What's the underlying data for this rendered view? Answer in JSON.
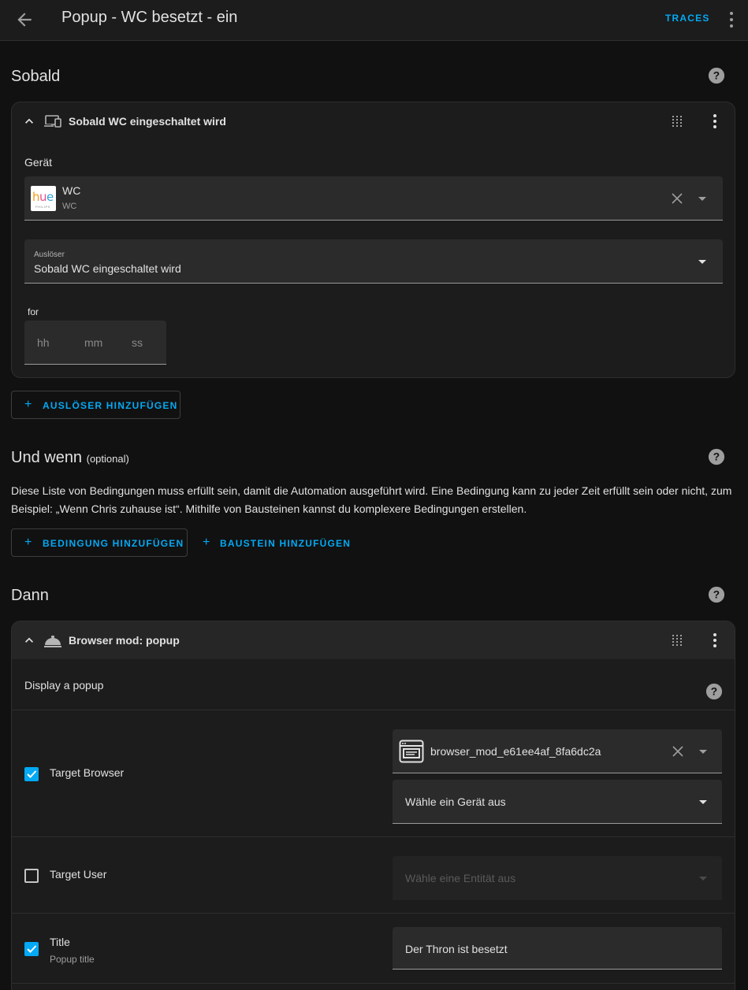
{
  "header": {
    "title": "Popup - WC besetzt - ein",
    "traces_label": "TRACES"
  },
  "triggers": {
    "section_title": "Sobald",
    "card": {
      "title": "Sobald WC eingeschaltet wird",
      "device_label": "Gerät",
      "device": {
        "name": "WC",
        "area": "WC",
        "logo_text": "hue",
        "logo_sub": "PHILIPS"
      },
      "trigger_field": {
        "label": "Auslöser",
        "value": "Sobald WC eingeschaltet wird"
      },
      "for_label": "for",
      "duration": {
        "hh": "hh",
        "mm": "mm",
        "ss": "ss"
      }
    },
    "add_button": "AUSLÖSER HINZUFÜGEN"
  },
  "conditions": {
    "section_title": "Und wenn",
    "optional": "(optional)",
    "description_line1": "Diese Liste von Bedingungen muss erfüllt sein, damit die Automation ausgeführt wird. Eine Bedingung kann zu jeder Zeit erfüllt sein oder nicht, zum",
    "description_line2": "Beispiel: „Wenn Chris zuhause ist“. Mithilfe von Bausteinen kannst du komplexere Bedingungen erstellen.",
    "add_condition_button": "BEDINGUNG HINZUFÜGEN",
    "add_building_block_button": "BAUSTEIN HINZUFÜGEN"
  },
  "actions": {
    "section_title": "Dann",
    "card": {
      "title": "Browser mod: popup",
      "description": "Display a popup",
      "target_browser": {
        "label": "Target Browser",
        "checked": true,
        "entity_value": "browser_mod_e61ee4af_8fa6dc2a",
        "device_placeholder": "Wähle ein Gerät aus"
      },
      "target_user": {
        "label": "Target User",
        "checked": false,
        "placeholder": "Wähle eine Entität aus"
      },
      "title_field": {
        "label": "Title",
        "sublabel": "Popup title",
        "checked": true,
        "value": "Der Thron ist besetzt"
      }
    }
  },
  "colors": {
    "accent": "#03a9f4",
    "background": "#111111",
    "card": "#1c1c1c"
  },
  "icons": [
    "arrow-left-icon",
    "dots-vertical-icon",
    "help-circle-icon",
    "chevron-up-icon",
    "devices-icon",
    "drag-icon",
    "close-icon",
    "menu-down-icon",
    "plus-icon",
    "bell-icon",
    "web-box-icon",
    "checkbox-icon"
  ]
}
